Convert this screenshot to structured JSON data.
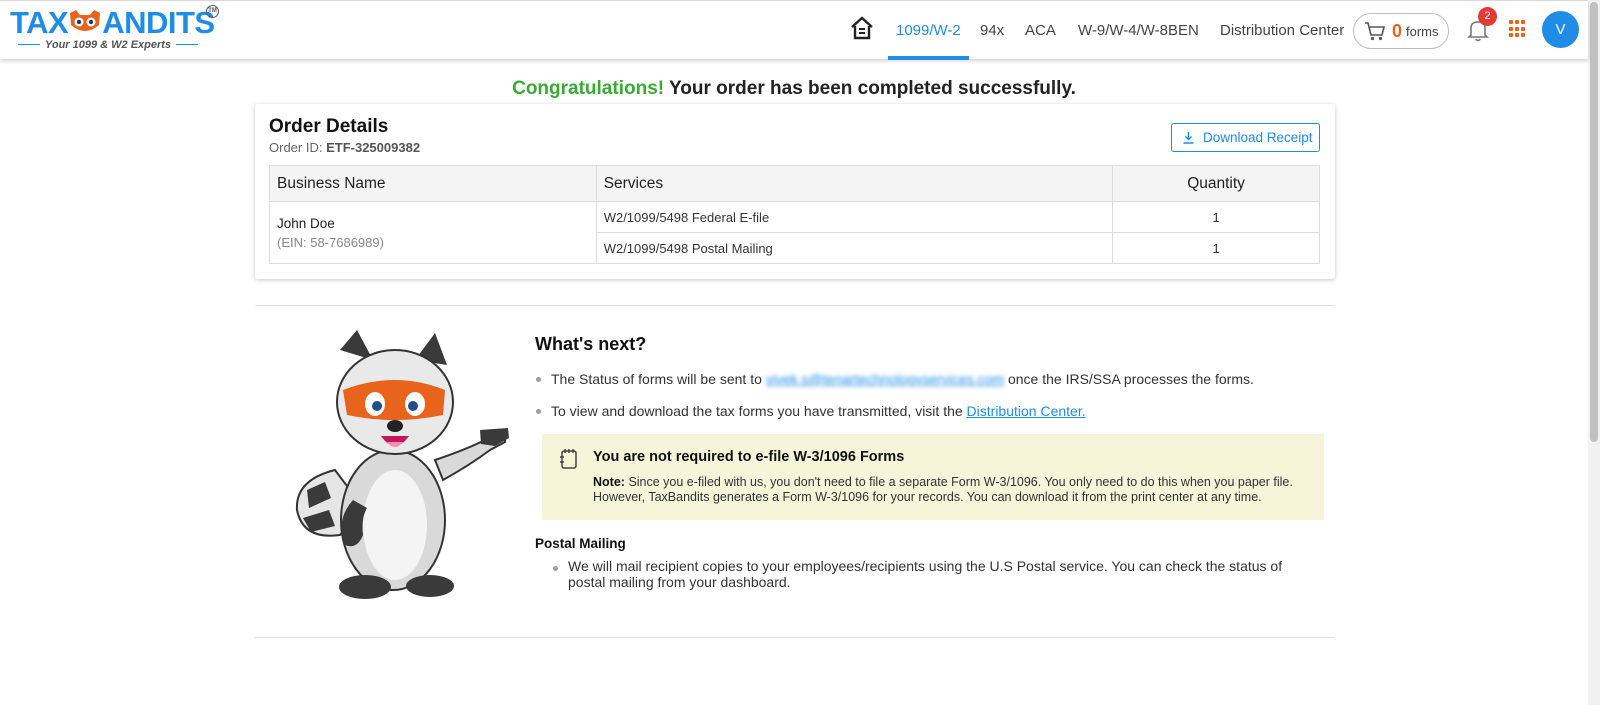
{
  "brand": {
    "name_left": "TAX",
    "name_right": "ANDITS",
    "tagline": "Your 1099 & W2 Experts",
    "trademark": "TM",
    "color_primary": "#1f8ce6",
    "color_accent": "#e8631c"
  },
  "nav": {
    "home_icon": "home-icon",
    "items": [
      {
        "label": "1099/W-2",
        "active": true
      },
      {
        "label": "94x",
        "active": false
      },
      {
        "label": "ACA",
        "active": false
      },
      {
        "label": "W-9/W-4/W-8BEN",
        "active": false
      },
      {
        "label": "Distribution Center",
        "active": false
      }
    ],
    "cart": {
      "count": "0",
      "label": "forms"
    },
    "notifications": "2",
    "avatar_initial": "V"
  },
  "main": {
    "congrats_highlight": "Congratulations!",
    "congrats_rest": "Your order has been completed successfully.",
    "order": {
      "title": "Order Details",
      "id_label": "Order ID:",
      "id_value": "ETF-325009382",
      "download_label": "Download Receipt",
      "columns": [
        "Business Name",
        "Services",
        "Quantity"
      ],
      "business_name": "John Doe",
      "business_ein": "(EIN: 58-7686989)",
      "rows": [
        {
          "service": "W2/1099/5498 Federal E-file",
          "quantity": "1"
        },
        {
          "service": "W2/1099/5498 Postal Mailing",
          "quantity": "1"
        }
      ]
    },
    "next": {
      "title": "What's next?",
      "bullet1_before": "The Status of forms will be sent to",
      "bullet1_email": "vivek.s@tenartechnologyservices.com",
      "bullet1_after": "once the IRS/SSA processes the forms.",
      "bullet2_before": "To view and download the tax forms you have transmitted, visit the",
      "bullet2_link": "Distribution Center.",
      "notice_title": "You are not required to e-file W-3/1096 Forms",
      "notice_note_label": "Note:",
      "notice_note": "Since you e-filed with us, you don't need to file a separate Form W-3/1096. You only need to do this when you paper file. However, TaxBandits generates a Form W-3/1096 for your records. You can download it from the print center at any time.",
      "postal_title": "Postal Mailing",
      "postal_text": "We will mail recipient copies to your employees/recipients using the U.S Postal service. You can check the status of postal mailing from your dashboard."
    }
  }
}
